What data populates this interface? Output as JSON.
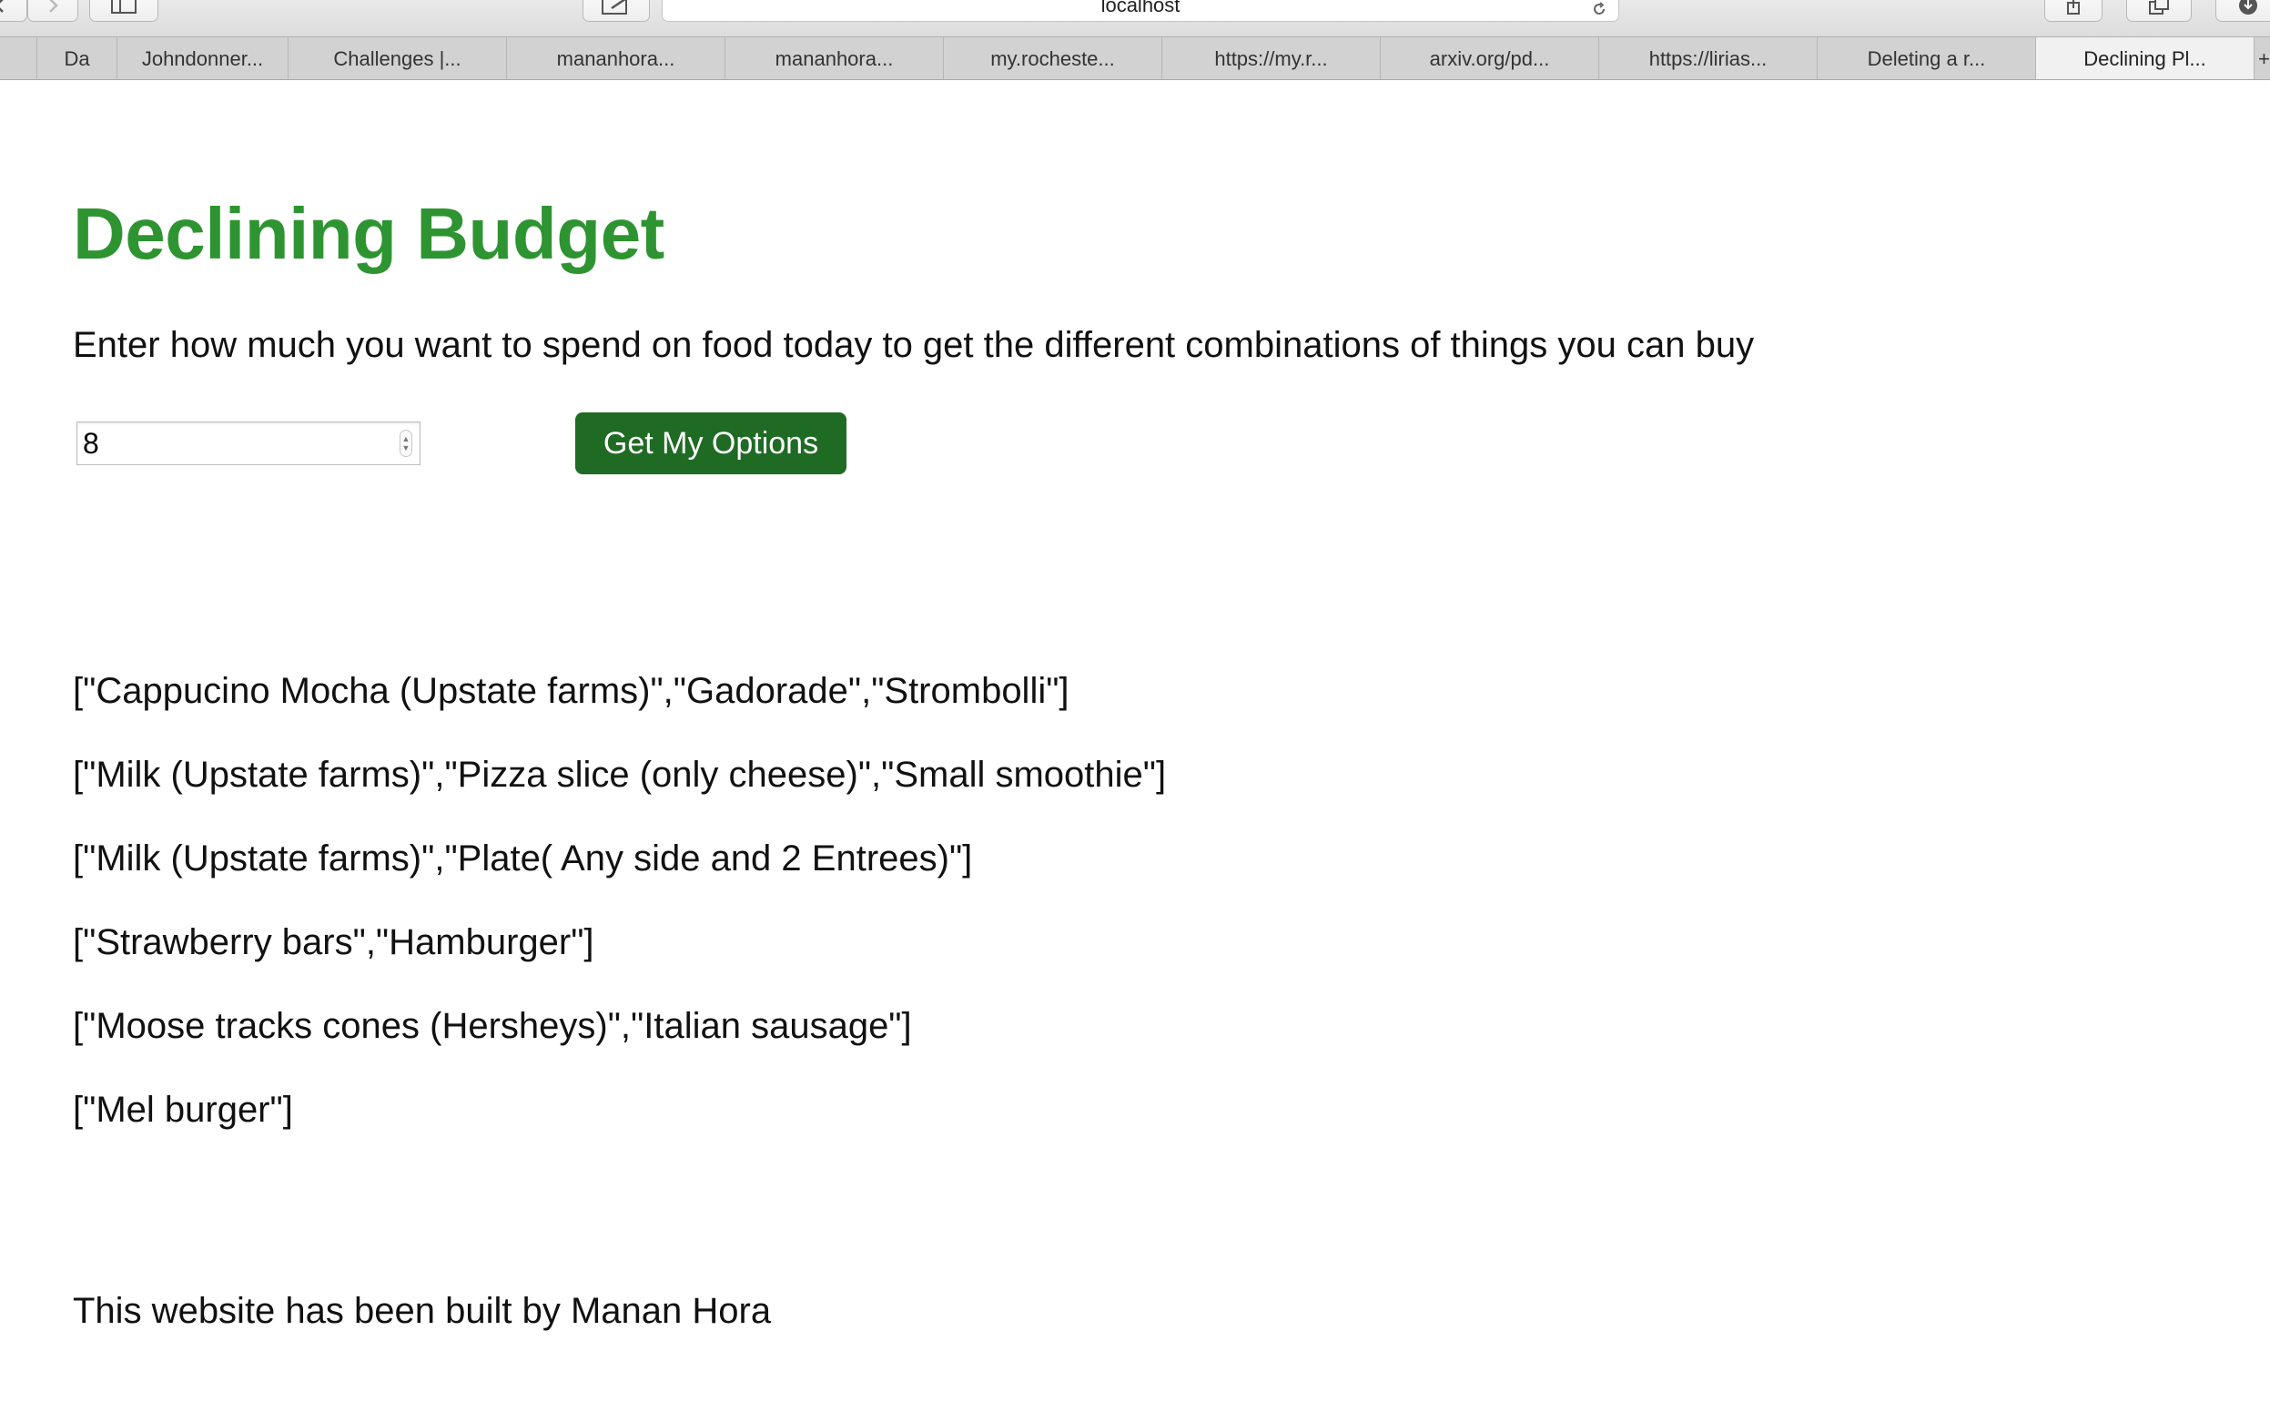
{
  "browser": {
    "address": "localhost",
    "tabs": [
      {
        "label": "Da",
        "active": false
      },
      {
        "label": "Johndonner...",
        "active": false
      },
      {
        "label": "Challenges |...",
        "active": false
      },
      {
        "label": "mananhora...",
        "active": false
      },
      {
        "label": "mananhora...",
        "active": false
      },
      {
        "label": "my.rocheste...",
        "active": false
      },
      {
        "label": "https://my.r...",
        "active": false
      },
      {
        "label": "arxiv.org/pd...",
        "active": false
      },
      {
        "label": "https://lirias...",
        "active": false
      },
      {
        "label": "Deleting a r...",
        "active": false
      },
      {
        "label": "Declining Pl...",
        "active": true
      }
    ]
  },
  "page": {
    "title": "Declining Budget",
    "instructions": "Enter how much you want to spend on food today to get the different combinations of things you can buy",
    "budget_input": {
      "value": "8"
    },
    "button_label": "Get My Options",
    "results": [
      "[\"Cappucino Mocha (Upstate farms)\",\"Gadorade\",\"Strombolli\"]",
      "[\"Milk (Upstate farms)\",\"Pizza slice (only cheese)\",\"Small smoothie\"]",
      "[\"Milk (Upstate farms)\",\"Plate( Any side and 2 Entrees)\"]",
      "[\"Strawberry bars\",\"Hamburger\"]",
      "[\"Moose tracks cones (Hersheys)\",\"Italian sausage\"]",
      "[\"Mel burger\"]"
    ],
    "footer": "This website has been built by Manan Hora"
  },
  "colors": {
    "title_green": "#2e9431",
    "button_green": "#1f6b24"
  }
}
